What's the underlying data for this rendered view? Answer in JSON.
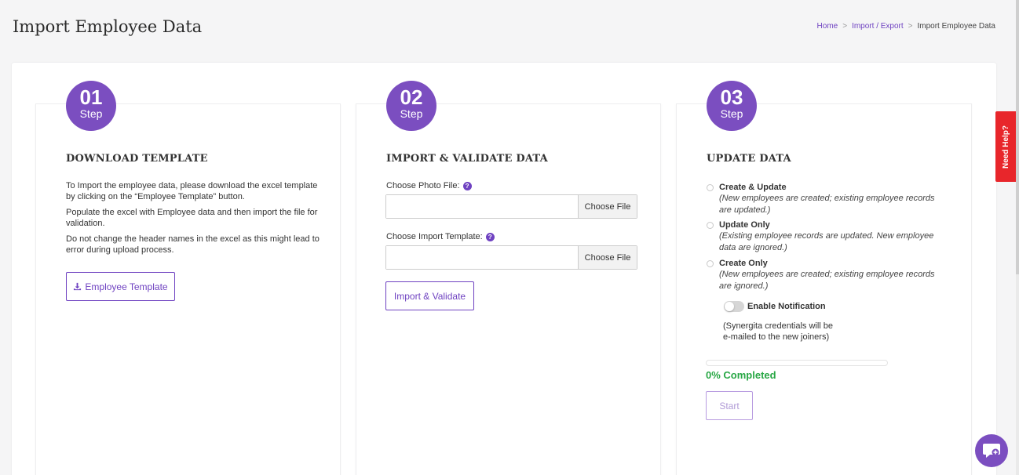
{
  "header": {
    "title": "Import Employee Data",
    "breadcrumb": {
      "home": "Home",
      "import_export": "Import / Export",
      "current": "Import Employee Data",
      "sep": ">"
    }
  },
  "steps": [
    {
      "num": "01",
      "word": "Step",
      "title": "DOWNLOAD TEMPLATE"
    },
    {
      "num": "02",
      "word": "Step",
      "title": "IMPORT & VALIDATE DATA"
    },
    {
      "num": "03",
      "word": "Step",
      "title": "UPDATE DATA"
    }
  ],
  "step1": {
    "p1": "To Import the employee data, please download the excel template by clicking on the “Employee Template” button.",
    "p2": "Populate the excel with Employee data and then import the file for validation.",
    "p3": "Do not change the header names in the excel as this might lead to error during upload process.",
    "button_label": "Employee Template"
  },
  "step2": {
    "photo_label": "Choose Photo File:",
    "template_label": "Choose Import Template:",
    "choose_file": "Choose File",
    "help": "?",
    "button_label": "Import & Validate"
  },
  "step3": {
    "options": [
      {
        "title": "Create & Update",
        "desc": "(New employees are created; existing employee records are updated.)"
      },
      {
        "title": "Update Only",
        "desc": "(Existing employee records are updated. New employee data are ignored.)"
      },
      {
        "title": "Create Only",
        "desc": "(New employees are created; existing employee records are ignored.)"
      }
    ],
    "toggle_label": "Enable Notification",
    "toggle_on": false,
    "note_line1": "(Synergita credentials will be",
    "note_line2": "e-mailed to the new joiners)",
    "progress_percent": 0,
    "progress_text": "0% Completed",
    "start_label": "Start"
  },
  "side": {
    "need_help": "Need Help?"
  },
  "colors": {
    "accent": "#7b4ec0",
    "success": "#28a745",
    "help_tab": "#e8262b"
  },
  "icons": {
    "download": "download-icon",
    "chat": "chat-icon",
    "help": "question-circle-icon"
  }
}
